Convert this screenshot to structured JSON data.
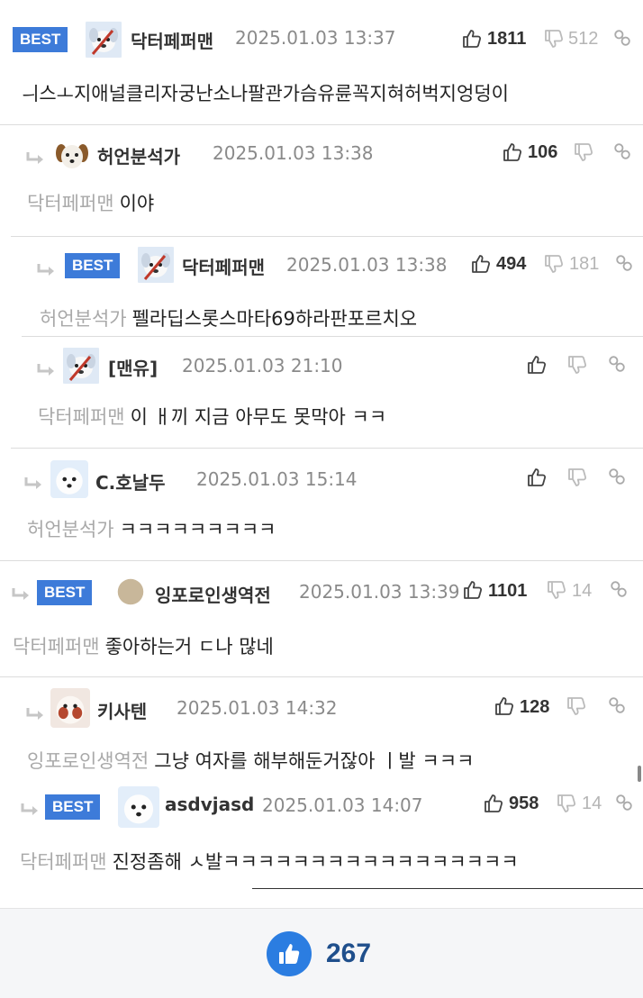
{
  "best_label": "BEST",
  "comments": [
    {
      "nickname": "닥터페퍼맨",
      "date": "2025.01.03 13:37",
      "up": "1811",
      "down": "512",
      "mention": "",
      "text": "ㅢ스ㅗ지애널클리자궁난소나팔관가슴유륜꼭지혀허벅지엉덩이"
    },
    {
      "nickname": "허언분석가",
      "date": "2025.01.03 13:38",
      "up": "106",
      "down": "",
      "mention": "닥터페퍼맨",
      "text": "이야"
    },
    {
      "nickname": "닥터페퍼맨",
      "date": "2025.01.03 13:38",
      "up": "494",
      "down": "181",
      "mention": "허언분석가",
      "text": "펠라딥스롯스마타69하라판포르치오"
    },
    {
      "nickname": "[맨유]",
      "date": "2025.01.03 21:10",
      "up": "",
      "down": "",
      "mention": "닥터페퍼맨",
      "text": "이 ㅐ끼 지금 아무도 못막아 ㅋㅋ"
    },
    {
      "nickname": "C.호날두",
      "date": "2025.01.03 15:14",
      "up": "",
      "down": "",
      "mention": "허언분석가",
      "text": "ㅋㅋㅋㅋㅋㅋㅋㅋㅋ"
    },
    {
      "nickname": "잉포로인생역전",
      "date": "2025.01.03 13:39",
      "up": "1101",
      "down": "14",
      "mention": "닥터페퍼맨",
      "text": "좋아하는거 ㄷ나 많네"
    },
    {
      "nickname": "키사텐",
      "date": "2025.01.03 14:32",
      "up": "128",
      "down": "",
      "mention": "잉포로인생역전",
      "text": "그냥 여자를 해부해둔거잖아 ㅣ발 ㅋㅋㅋ"
    },
    {
      "nickname": "asdvjasd",
      "date": "2025.01.03 14:07",
      "up": "958",
      "down": "14",
      "mention": "닥터페퍼맨",
      "text": "진정좀해 ㅅ발ㅋㅋㅋㅋㅋㅋㅋㅋㅋㅋㅋㅋㅋㅋㅋㅋㅋ"
    }
  ],
  "footer": {
    "like_count": "267"
  },
  "icons": [
    "thumbs-up-icon",
    "thumbs-down-icon",
    "link-icon",
    "reply-arrow-icon",
    "avatar-icon"
  ],
  "colors": {
    "best_badge": "#3d7bd9",
    "like_button": "#2b7de1",
    "mention": "#a9a9a9"
  }
}
